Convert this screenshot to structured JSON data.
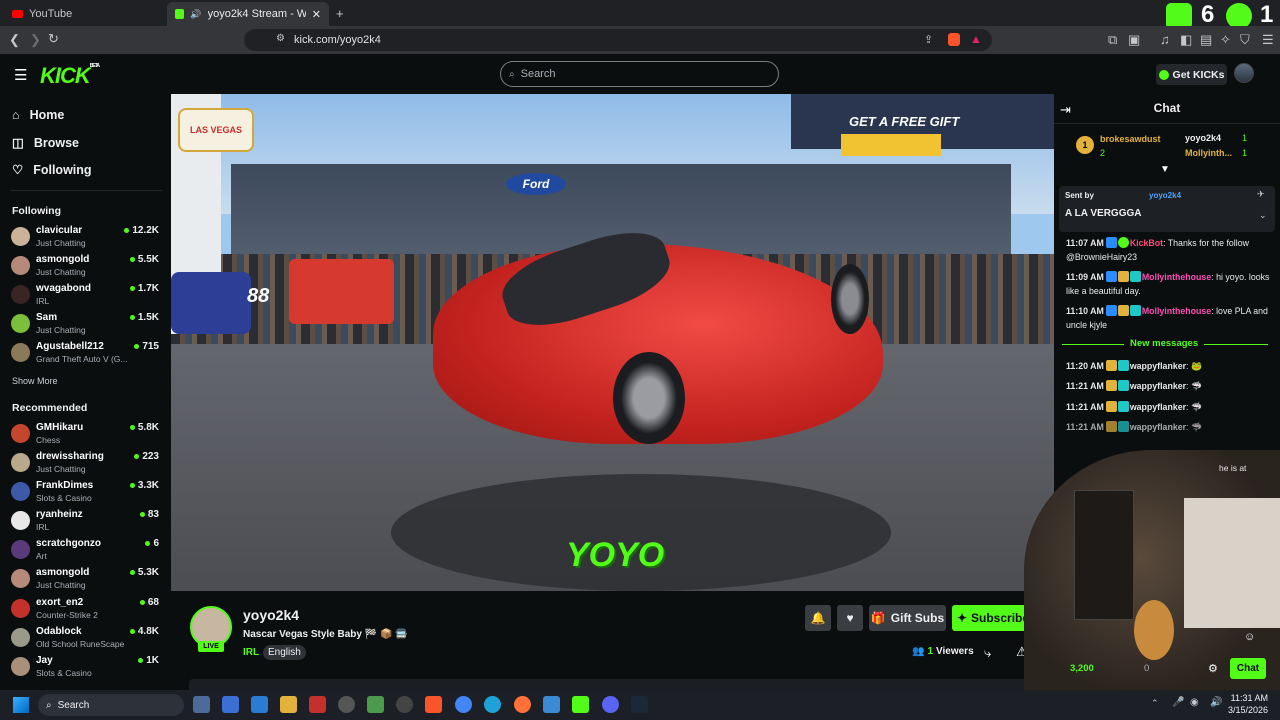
{
  "browser": {
    "tabs": [
      {
        "label": "YouTube"
      },
      {
        "label": "yoyo2k4 Stream - Watch Live"
      }
    ],
    "url": "kick.com/yoyo2k4",
    "overlay_left": "6",
    "overlay_right": "1"
  },
  "header": {
    "logo": "KICK",
    "beta": "BETA",
    "search_placeholder": "Search",
    "get_kicks": "Get KICKs"
  },
  "nav": [
    {
      "label": "Home"
    },
    {
      "label": "Browse"
    },
    {
      "label": "Following"
    }
  ],
  "following": {
    "title": "Following",
    "channels": [
      {
        "name": "clavicular",
        "category": "Just Chatting",
        "viewers": "12.2K"
      },
      {
        "name": "asmongold",
        "category": "Just Chatting",
        "viewers": "5.5K"
      },
      {
        "name": "wvagabond",
        "category": "IRL",
        "viewers": "1.7K"
      },
      {
        "name": "Sam",
        "category": "Just Chatting",
        "viewers": "1.5K"
      },
      {
        "name": "Agustabell212",
        "category": "Grand Theft Auto V (G...",
        "viewers": "715"
      }
    ],
    "show_more": "Show More"
  },
  "recommended": {
    "title": "Recommended",
    "channels": [
      {
        "name": "GMHikaru",
        "category": "Chess",
        "viewers": "5.8K"
      },
      {
        "name": "drewissharing",
        "category": "Just Chatting",
        "viewers": "223"
      },
      {
        "name": "FrankDimes",
        "category": "Slots & Casino",
        "viewers": "3.3K"
      },
      {
        "name": "ryanheinz",
        "category": "IRL",
        "viewers": "83"
      },
      {
        "name": "scratchgonzo",
        "category": "Art",
        "viewers": "6"
      },
      {
        "name": "asmongold",
        "category": "Just Chatting",
        "viewers": "5.3K"
      },
      {
        "name": "exort_en2",
        "category": "Counter-Strike 2",
        "viewers": "68"
      },
      {
        "name": "Odablock",
        "category": "Old School RuneScape",
        "viewers": "4.8K"
      },
      {
        "name": "Jay",
        "category": "Slots & Casino",
        "viewers": "1K"
      }
    ]
  },
  "video": {
    "sign_text": "LAS VEGAS",
    "banner": "GET A FREE GIFT",
    "brand": "Ford",
    "watermark": "YOYO",
    "car_number": "88"
  },
  "stream": {
    "streamer": "yoyo2k4",
    "title": "Nascar Vegas Style Baby 🏁 📦 🚍",
    "live": "LIVE",
    "tags": [
      "IRL",
      "English"
    ],
    "viewers_count": "1",
    "viewers_label": "Viewers",
    "gift_subs": "Gift Subs",
    "subscribe": "Subscribe"
  },
  "chat": {
    "title": "Chat",
    "leaderboard": [
      {
        "rank": "1",
        "name": "brokesawdust",
        "count": "2"
      },
      {
        "name": "yoyo2k4",
        "count": "1"
      },
      {
        "name": "Mollyinth...",
        "count": "1"
      }
    ],
    "pinned": {
      "sent_by": "Sent by",
      "author": "yoyo2k4",
      "text": "A LA VERGGGA"
    },
    "messages": [
      {
        "time": "11:07 AM",
        "user": "KickBot",
        "text": ": Thanks for the follow @BrownieHairy23"
      },
      {
        "time": "11:09 AM",
        "user": "Mollyinthehouse",
        "text": ": hi yoyo. looks like a beautiful day."
      },
      {
        "time": "11:10 AM",
        "user": "Mollyinthehouse",
        "text": ": love PLA and uncle kjyle"
      }
    ],
    "new_messages": "New messages",
    "new": [
      {
        "time": "11:20 AM",
        "user": "wappyflanker"
      },
      {
        "time": "11:21 AM",
        "user": "wappyflanker"
      },
      {
        "time": "11:21 AM",
        "user": "wappyflanker"
      },
      {
        "time": "11:21 AM",
        "user": "wappyflanker"
      }
    ],
    "partial_text": "he is at",
    "points": "3,200",
    "points_other": "0",
    "chat_button": "Chat",
    "colors": {
      "kickbot": "#ff4d7a",
      "molly": "#ff4db8",
      "wappy": "#e6e6e6"
    }
  },
  "taskbar": {
    "search": "Search",
    "time": "11:31 AM",
    "date": "3/15/2026"
  },
  "colors": {
    "accent": "#53fc18",
    "bg": "#0b0e0f"
  }
}
